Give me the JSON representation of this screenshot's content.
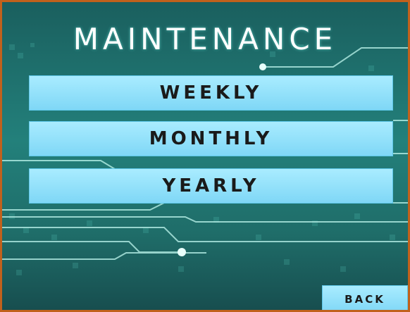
{
  "screen": {
    "title": "MAINTENANCE",
    "border_color": "#c1611c",
    "accent_color": "#8fe0f9"
  },
  "menu": {
    "weekly_label": "WEEKLY",
    "monthly_label": "MONTHLY",
    "yearly_label": "YEARLY"
  },
  "footer": {
    "back_label": "BACK"
  }
}
